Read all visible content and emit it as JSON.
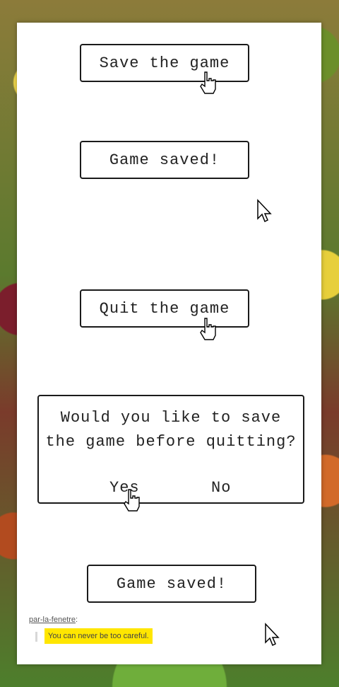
{
  "buttons": {
    "save": "Save the game",
    "saved_1": "Game saved!",
    "quit": "Quit the game",
    "saved_2": "Game saved!"
  },
  "dialog": {
    "line1": "Would you like to save",
    "line2": "the game before quitting?",
    "yes": "Yes",
    "no": "No"
  },
  "credit": {
    "author": "par-la-fenetre",
    "separator": ":",
    "quote": "You can never be too careful."
  }
}
